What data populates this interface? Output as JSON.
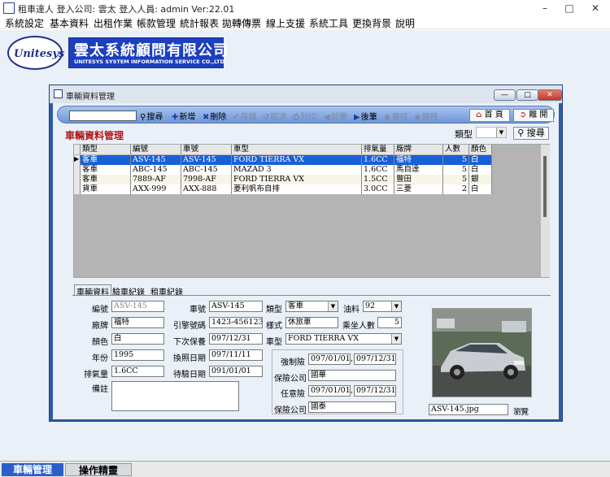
{
  "titlebar": {
    "title": "租車達人  登入公司: 雲太  登入人員: admin Ver:22.01"
  },
  "menu": [
    "系統設定",
    "基本資料",
    "出租作業",
    "帳款管理",
    "統計報表",
    "拋轉傳票",
    "線上支援",
    "系統工具",
    "更換背景",
    "說明"
  ],
  "logo": {
    "text": "Unitesys",
    "company_zh": "雲太系統顧問有限公司",
    "company_en": "UNITESYS SYSTEM INFORMATION SERVICE CO.,LTD."
  },
  "window": {
    "title": "車輛資料管理"
  },
  "toolbar": {
    "search": "搜尋",
    "add": "新增",
    "delete": "刪除",
    "save": "存檔",
    "cancel": "取消",
    "print": "列印",
    "prev": "前筆",
    "next": "後筆",
    "audit": "審核",
    "unaudit": "解核",
    "home": "首 頁",
    "exit": "離 開"
  },
  "section": {
    "title": "車輛資料管理",
    "type_label": "類型",
    "search_button": "搜尋"
  },
  "grid": {
    "headers": [
      "類型",
      "編號",
      "車號",
      "車型",
      "排氣量",
      "廠牌",
      "人數",
      "顏色"
    ],
    "rows": [
      [
        "客車",
        "ASV-145",
        "ASV-145",
        "FORD TIERRA VX",
        "1.6CC",
        "福特",
        "5",
        "白"
      ],
      [
        "客車",
        "ABC-145",
        "ABC-145",
        "MAZAD 3",
        "1.6CC",
        "馬自達",
        "5",
        "白"
      ],
      [
        "客車",
        "7889-AF",
        "7998-AF",
        "FORD TIERRA VX",
        "1.5CC",
        "豐田",
        "5",
        "銀"
      ],
      [
        "貨車",
        "AXX-999",
        "AXX-888",
        "菱利帆布自排",
        "3.0CC",
        "三菱",
        "2",
        "白"
      ]
    ]
  },
  "tabs": [
    "車輛資料",
    "驗車紀錄",
    "租車紀錄"
  ],
  "form": {
    "labels": {
      "id": "編號",
      "brand": "廠牌",
      "color": "顏色",
      "year": "年份",
      "cc": "排氣量",
      "note": "備註",
      "plate": "車號",
      "engine": "引擎號碼",
      "next_service": "下次保養",
      "reissue": "換照日期",
      "inspection": "待驗日期",
      "type": "類型",
      "style": "樣式",
      "model": "車型",
      "fuel": "油料",
      "seats": "乘坐人數",
      "mandatory": "強制險",
      "insurer1": "保險公司",
      "optional": "任意險",
      "insurer2": "保險公司"
    },
    "values": {
      "id": "ASV-145",
      "brand": "福特",
      "color": "白",
      "year": "1995",
      "cc": "1.6CC",
      "note": "",
      "plate": "ASV-145",
      "engine": "1423-456123",
      "next_service": "097/12/31",
      "reissue": "097/11/11",
      "inspection": "091/01/01",
      "type": "客車",
      "style": "休旅車",
      "model": "FORD TIERRA VX",
      "fuel": "92",
      "seats": "5",
      "mandatory_from": "097/01/01",
      "mandatory_to": "097/12/31",
      "insurer1": "國華",
      "optional_from": "097/01/01",
      "optional_to": "097/12/31",
      "insurer2": "國泰",
      "photo_file": "ASV-145.jpg",
      "browse": "瀏覽"
    }
  },
  "bottom_tabs": [
    "車輛管理",
    "操作精靈"
  ]
}
